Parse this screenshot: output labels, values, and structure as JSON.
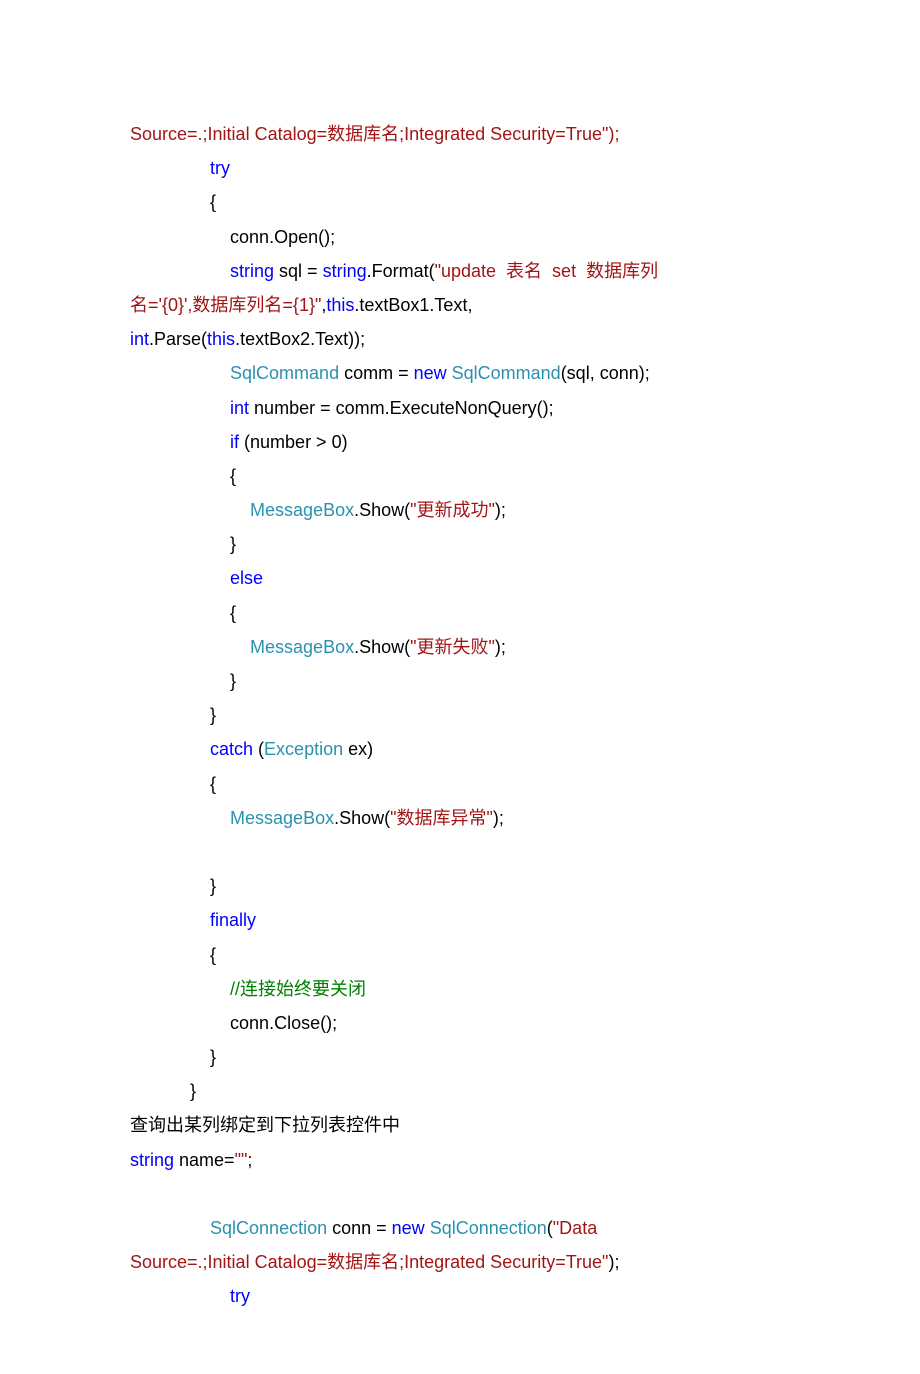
{
  "line01_a": "Source=.;Initial Catalog=数据库名;Integrated Security=True\");",
  "try": "try",
  "brace_open": "{",
  "brace_close": "}",
  "conn_open": "                    conn.Open();",
  "string_kw": "string",
  "sql_eq": " sql = ",
  "format": ".Format(",
  "sql_str": "\"update  表名  set  数据库列",
  "sql_str2_a": "名='{0}',数据库列名={1}\"",
  "comma": ",",
  "this": "this",
  "tb1": ".textBox1.Text,",
  "int": "int ",
  "int_kw": "int",
  "parse": ".Parse(",
  "tb2": ".textBox2.Text));",
  "sqlcmd": "SqlCommand",
  "comm_eq": " comm = ",
  "new": "new",
  "sqlcmd_args": "(sql, conn);",
  "number_line": " number = comm.ExecuteNonQuery();",
  "if": "if",
  "if_cond": " (number > 0)",
  "msgbox": "MessageBox",
  "show_success": ".Show(",
  "str_success": "\"更新成功\"",
  "paren_semi": ");",
  "else": "else",
  "str_fail": "\"更新失败\"",
  "catch": "catch",
  "exception": "Exception",
  "ex": " ex)",
  "str_dbexc": "\"数据库异常\"",
  "finally": "finally",
  "comment_close": "//连接始终要关闭",
  "conn_close": "                    conn.Close();",
  "heading": "查询出某列绑定到下拉列表控件中",
  "string_name_a": "string",
  "string_name_b": " name=",
  "string_name_c": "\"\"",
  "string_name_d": ";",
  "sqlconn": "SqlConnection",
  "conn_eq": " conn = ",
  "sqlconn_open": "(",
  "data_str": "\"Data ",
  "source_str": "Source=.;Initial Catalog=数据库名;Integrated Security=True\"",
  "close_paren": ");",
  "sp_catch_open": " ("
}
